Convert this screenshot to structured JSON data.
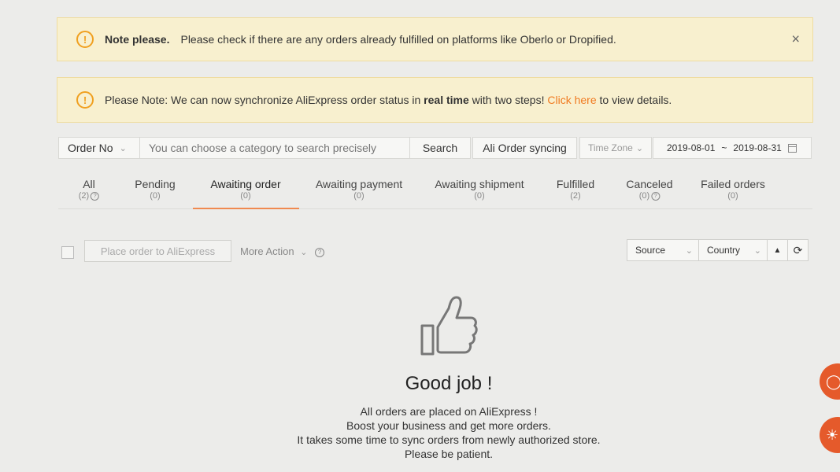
{
  "notices": {
    "first": {
      "title": "Note please.",
      "text": "Please check if there are any orders already fulfilled on platforms like Oberlo or Dropified.",
      "close_label": "×"
    },
    "second": {
      "prefix": "Please Note: We can now synchronize AliExpress order status in ",
      "bold": "real time",
      "middle": " with two steps! ",
      "link": "Click here",
      "suffix": " to view details."
    }
  },
  "toolbar": {
    "search_field": "Order No",
    "search_placeholder": "You can choose a category to search precisely",
    "search_button": "Search",
    "sync_button": "Ali Order syncing",
    "time_zone": "Time Zone",
    "date_start": "2019-08-01",
    "date_sep": "~",
    "date_end": "2019-08-31"
  },
  "tabs": [
    {
      "label": "All",
      "count": "(2)"
    },
    {
      "label": "Pending",
      "count": "(0)"
    },
    {
      "label": "Awaiting order",
      "count": "(0)"
    },
    {
      "label": "Awaiting payment",
      "count": "(0)"
    },
    {
      "label": "Awaiting shipment",
      "count": "(0)"
    },
    {
      "label": "Fulfilled",
      "count": "(2)"
    },
    {
      "label": "Canceled",
      "count": "(0)"
    },
    {
      "label": "Failed orders",
      "count": "(0)"
    }
  ],
  "active_tab": "Awaiting order",
  "actions": {
    "place_order": "Place order to AliExpress",
    "more_action": "More Action",
    "source": "Source",
    "country": "Country"
  },
  "empty_state": {
    "title": "Good job !",
    "lines": [
      "All orders are placed on AliExpress !",
      "Boost your business and get more orders.",
      "It takes some time to sync orders from newly authorized store.",
      "Please be patient."
    ]
  },
  "colors": {
    "notice_bg": "#f8f0cf",
    "warning": "#f0a020",
    "link": "#f07a20",
    "tab_underline": "#f08a50",
    "badge": "#e55a2b"
  }
}
